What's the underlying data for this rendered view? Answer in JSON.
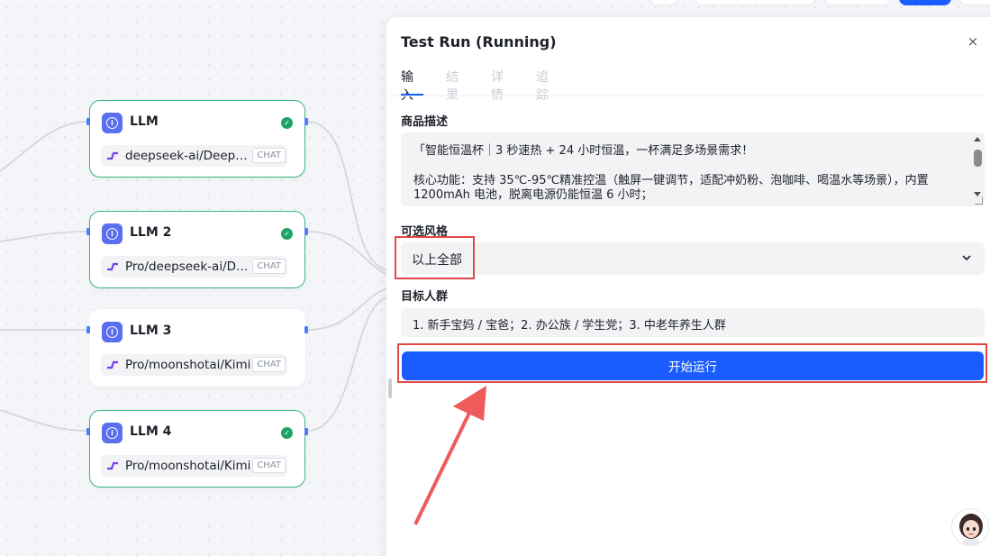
{
  "nodes": [
    {
      "title": "LLM",
      "model": "deepseek-ai/DeepSeek",
      "tag": "CHAT",
      "status": "success"
    },
    {
      "title": "LLM 2",
      "model": "Pro/deepseek-ai/DeepSeek",
      "tag": "CHAT",
      "status": "success"
    },
    {
      "title": "LLM 3",
      "model": "Pro/moonshotai/Kimi",
      "tag": "CHAT",
      "status": "idle"
    },
    {
      "title": "LLM 4",
      "model": "Pro/moonshotai/Kimi",
      "tag": "CHAT",
      "status": "success"
    }
  ],
  "panel": {
    "title": "Test Run (Running)",
    "close": "×",
    "tabs": [
      "输入",
      "结果",
      "详情",
      "追踪"
    ],
    "active_tab": "输入",
    "fields": {
      "description": {
        "label": "商品描述",
        "lines": [
          "「智能恒温杯｜3 秒速热 + 24 小时恒温，一杯满足多场景需求！",
          "",
          "核心功能：支持 35℃-95℃精准控温（触屏一键调节，适配冲奶粉、泡咖啡、喝温水等场景），内置",
          "1200mAh 电池，脱离电源仍能恒温 6 小时；"
        ]
      },
      "style": {
        "label": "可选风格",
        "value": "以上全部"
      },
      "audience": {
        "label": "目标人群",
        "value": "1. 新手宝妈 / 宝爸；2. 办公族 / 学生党；3. 中老年养生人群"
      }
    },
    "run_button": "开始运行"
  },
  "colors": {
    "primary": "#1a5cff",
    "success": "#1fa364",
    "node_border": "#3ab77e",
    "annotation": "#e04848"
  }
}
